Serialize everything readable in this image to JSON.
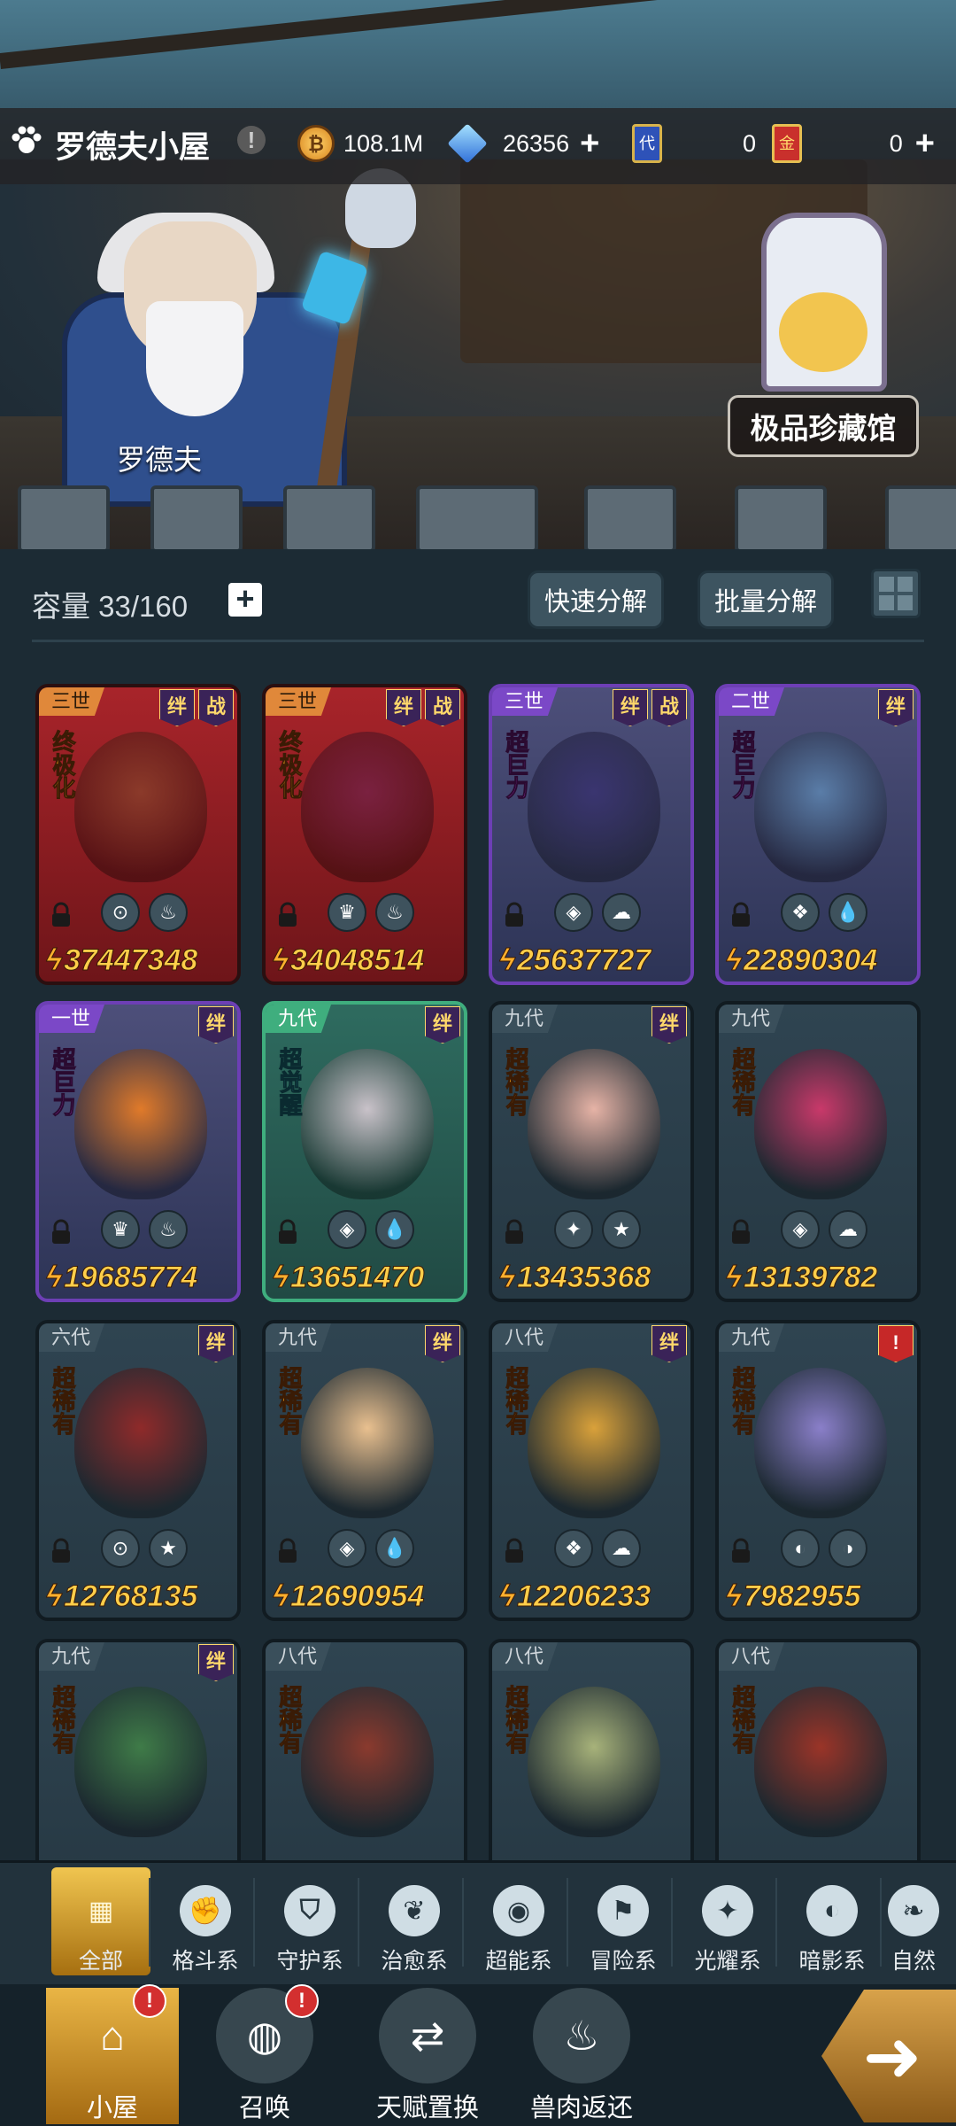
{
  "header": {
    "house_title": "罗德夫小屋",
    "warn_mark": "!",
    "npc_name": "罗德夫",
    "museum_label": "极品珍藏馆"
  },
  "resources": {
    "gold": "108.1M",
    "gold_icon": "gold-coin-icon",
    "crystal": "26356",
    "ticket_blue_label": "代",
    "ticket_blue": "0",
    "ticket_red_label": "金",
    "ticket_red": "0",
    "plus": "+"
  },
  "inventory": {
    "capacity": "容量 33/160",
    "plus": "+",
    "quick_decompose": "快速分解",
    "batch_decompose": "批量分解"
  },
  "cards": [
    {
      "gen": "三世",
      "rarity": "终极化",
      "style": "red",
      "rar": "gold",
      "badges": [
        "绊",
        "战"
      ],
      "power": "37447348",
      "elems": [
        "⊙",
        "♨"
      ],
      "body": "#8b3a2a"
    },
    {
      "gen": "三世",
      "rarity": "终极化",
      "style": "red",
      "rar": "gold",
      "badges": [
        "绊",
        "战"
      ],
      "power": "34048514",
      "elems": [
        "♛",
        "♨"
      ],
      "body": "#7a2140"
    },
    {
      "gen": "三世",
      "rarity": "超巨力",
      "style": "purple",
      "rar": "pink",
      "badges": [
        "绊",
        "战"
      ],
      "power": "25637727",
      "elems": [
        "◈",
        "☁"
      ],
      "body": "#3a3570"
    },
    {
      "gen": "二世",
      "rarity": "超巨力",
      "style": "purple",
      "rar": "pink",
      "badges": [
        "绊"
      ],
      "power": "22890304",
      "elems": [
        "❖",
        "💧"
      ],
      "body": "#5a7da8"
    },
    {
      "gen": "一世",
      "rarity": "超巨力",
      "style": "purple",
      "rar": "pink",
      "badges": [
        "绊"
      ],
      "power": "19685774",
      "elems": [
        "♛",
        "♨"
      ],
      "body": "#e07a2a"
    },
    {
      "gen": "九代",
      "rarity": "超觉醒",
      "style": "green",
      "rar": "cyan",
      "badges": [
        "绊"
      ],
      "power": "13651470",
      "elems": [
        "◈",
        "💧"
      ],
      "body": "#c9c2c9"
    },
    {
      "gen": "九代",
      "rarity": "超稀有",
      "style": "gray",
      "rar": "gold",
      "badges": [
        "绊"
      ],
      "power": "13435368",
      "elems": [
        "✦",
        "★"
      ],
      "body": "#e6b3a6"
    },
    {
      "gen": "九代",
      "rarity": "超稀有",
      "style": "gray",
      "rar": "gold",
      "badges": [],
      "power": "13139782",
      "elems": [
        "◈",
        "☁"
      ],
      "body": "#c9396a"
    },
    {
      "gen": "六代",
      "rarity": "超稀有",
      "style": "gray",
      "rar": "gold",
      "badges": [
        "绊"
      ],
      "power": "12768135",
      "elems": [
        "⊙",
        "★"
      ],
      "body": "#8f2a2a"
    },
    {
      "gen": "九代",
      "rarity": "超稀有",
      "style": "gray",
      "rar": "gold",
      "badges": [
        "绊"
      ],
      "power": "12690954",
      "elems": [
        "◈",
        "💧"
      ],
      "body": "#e9c08f"
    },
    {
      "gen": "八代",
      "rarity": "超稀有",
      "style": "gray",
      "rar": "gold",
      "badges": [
        "绊"
      ],
      "power": "12206233",
      "elems": [
        "❖",
        "☁"
      ],
      "body": "#d9a13a"
    },
    {
      "gen": "九代",
      "rarity": "超稀有",
      "style": "gray",
      "rar": "gold",
      "badges": [
        "!"
      ],
      "power": "7982955",
      "elems": [
        "◐",
        "◑"
      ],
      "body": "#8a7fc9"
    },
    {
      "gen": "九代",
      "rarity": "超稀有",
      "style": "gray",
      "rar": "gold",
      "badges": [
        "绊"
      ],
      "power": "",
      "elems": [],
      "body": "#3f7b48"
    },
    {
      "gen": "八代",
      "rarity": "超稀有",
      "style": "gray",
      "rar": "gold",
      "badges": [],
      "power": "",
      "elems": [],
      "body": "#8a3a2e"
    },
    {
      "gen": "八代",
      "rarity": "超稀有",
      "style": "gray",
      "rar": "gold",
      "badges": [],
      "power": "",
      "elems": [],
      "body": "#a7b27a"
    },
    {
      "gen": "八代",
      "rarity": "超稀有",
      "style": "gray",
      "rar": "gold",
      "badges": [],
      "power": "",
      "elems": [],
      "body": "#9a3428"
    }
  ],
  "categories": [
    {
      "label": "全部",
      "icon": "all-blocks-icon",
      "glyph": "▦",
      "active": true
    },
    {
      "label": "格斗系",
      "icon": "fist-icon",
      "glyph": "✊",
      "active": false
    },
    {
      "label": "守护系",
      "icon": "shield-icon",
      "glyph": "⛉",
      "active": false
    },
    {
      "label": "治愈系",
      "icon": "sprout-icon",
      "glyph": "❦",
      "active": false
    },
    {
      "label": "超能系",
      "icon": "psychic-icon",
      "glyph": "◉",
      "active": false
    },
    {
      "label": "冒险系",
      "icon": "adventure-icon",
      "glyph": "⚑",
      "active": false
    },
    {
      "label": "光耀系",
      "icon": "light-icon",
      "glyph": "✦",
      "active": false
    },
    {
      "label": "暗影系",
      "icon": "shadow-icon",
      "glyph": "◐",
      "active": false
    },
    {
      "label": "自然",
      "icon": "nature-icon",
      "glyph": "❧",
      "active": false
    }
  ],
  "nav": [
    {
      "label": "小屋",
      "icon": "house-icon",
      "glyph": "⌂",
      "active": true,
      "alert": "!"
    },
    {
      "label": "召唤",
      "icon": "egg-icon",
      "glyph": "◍",
      "active": false,
      "alert": "!"
    },
    {
      "label": "天赋置换",
      "icon": "swap-icon",
      "glyph": "⇄",
      "active": false,
      "alert": ""
    },
    {
      "label": "兽肉返还",
      "icon": "meat-icon",
      "glyph": "♨",
      "active": false,
      "alert": ""
    }
  ],
  "colors": {
    "accent": "#f0c550",
    "power": "#ffce4a",
    "alert": "#d32f2f"
  }
}
